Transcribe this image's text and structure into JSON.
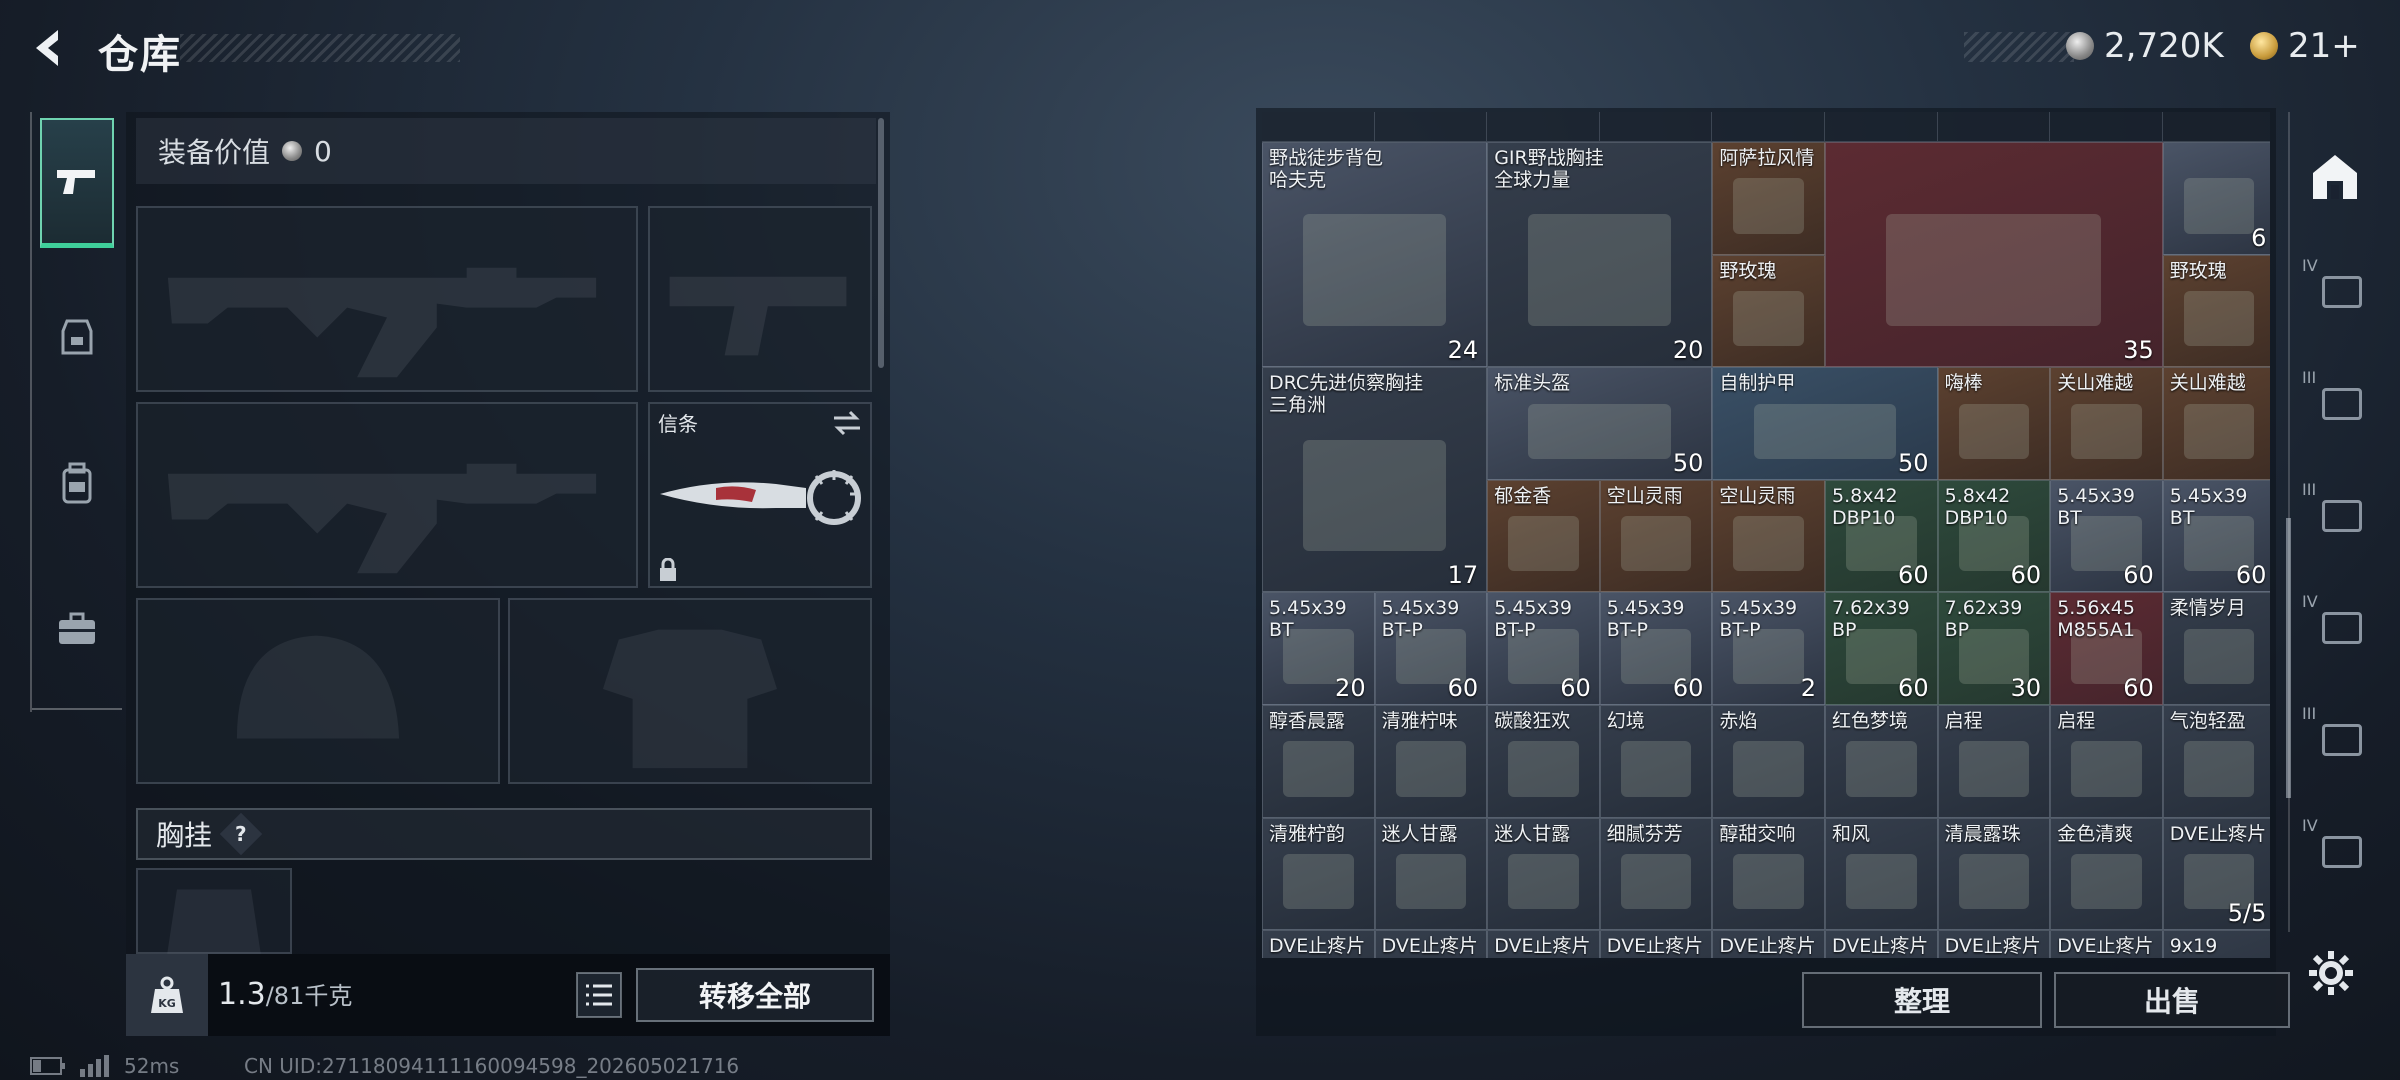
{
  "header": {
    "title": "仓库",
    "currency_silver": "2,720K",
    "currency_gold": "21+"
  },
  "equipment": {
    "value_label": "装备价值",
    "value_amount": "0",
    "knife_slot_label": "信条",
    "chest_rig_label": "胸挂",
    "chest_rig_help": "?",
    "weight_current": "1.3",
    "weight_max": "/81千克",
    "weight_icon_text": "KG",
    "transfer_all": "转移全部"
  },
  "storage": {
    "buttons": {
      "sort": "整理",
      "sell": "出售"
    },
    "items": [
      {
        "name": "野战徒步背包\n哈夫克",
        "count": "24",
        "color": "grey"
      },
      {
        "name": "GIR野战胸挂\n全球力量",
        "count": "20",
        "color": "dark"
      },
      {
        "name": "阿萨拉风情",
        "count": "",
        "color": "orange"
      },
      {
        "name": "",
        "count": "35",
        "color": "red"
      },
      {
        "name": "",
        "count": "6",
        "color": "grey"
      },
      {
        "name": "野玫瑰",
        "count": "",
        "color": "orange"
      },
      {
        "name": "野玫瑰",
        "count": "",
        "color": "orange"
      },
      {
        "name": "DRC先进侦察胸挂\n三角洲",
        "count": "17",
        "color": "dark"
      },
      {
        "name": "标准头盔",
        "count": "50",
        "color": "grey"
      },
      {
        "name": "自制护甲",
        "count": "50",
        "color": "blue"
      },
      {
        "name": "嗨棒",
        "count": "",
        "color": "orange"
      },
      {
        "name": "关山难越",
        "count": "",
        "color": "orange"
      },
      {
        "name": "关山难越",
        "count": "",
        "color": "orange"
      },
      {
        "name": "郁金香",
        "count": "",
        "color": "orange"
      },
      {
        "name": "空山灵雨",
        "count": "",
        "color": "orange"
      },
      {
        "name": "空山灵雨",
        "count": "",
        "color": "orange"
      },
      {
        "name": "5.8x42\nDBP10",
        "count": "60",
        "color": "green"
      },
      {
        "name": "5.8x42\nDBP10",
        "count": "60",
        "color": "green"
      },
      {
        "name": "5.45x39\nBT",
        "count": "60",
        "color": "grey"
      },
      {
        "name": "5.45x39\nBT",
        "count": "60",
        "color": "grey"
      },
      {
        "name": "5.45x39\nBT",
        "count": "20",
        "color": "grey"
      },
      {
        "name": "5.45x39\nBT-P",
        "count": "60",
        "color": "grey"
      },
      {
        "name": "5.45x39\nBT-P",
        "count": "60",
        "color": "grey"
      },
      {
        "name": "5.45x39\nBT-P",
        "count": "60",
        "color": "grey"
      },
      {
        "name": "5.45x39\nBT-P",
        "count": "2",
        "color": "grey"
      },
      {
        "name": "7.62x39\nBP",
        "count": "60",
        "color": "green"
      },
      {
        "name": "7.62x39\nBP",
        "count": "30",
        "color": "green"
      },
      {
        "name": "5.56x45\nM855A1",
        "count": "60",
        "color": "red"
      },
      {
        "name": "柔情岁月",
        "count": "",
        "color": "dark"
      },
      {
        "name": "醇香晨露",
        "count": "",
        "color": "dark"
      },
      {
        "name": "清雅柠味",
        "count": "",
        "color": "dark"
      },
      {
        "name": "碳酸狂欢",
        "count": "",
        "color": "dark"
      },
      {
        "name": "幻境",
        "count": "",
        "color": "dark"
      },
      {
        "name": "赤焰",
        "count": "",
        "color": "dark"
      },
      {
        "name": "红色梦境",
        "count": "",
        "color": "dark"
      },
      {
        "name": "启程",
        "count": "",
        "color": "dark"
      },
      {
        "name": "启程",
        "count": "",
        "color": "dark"
      },
      {
        "name": "气泡轻盈",
        "count": "",
        "color": "dark"
      },
      {
        "name": "清雅柠韵",
        "count": "",
        "color": "dark"
      },
      {
        "name": "迷人甘露",
        "count": "",
        "color": "dark"
      },
      {
        "name": "迷人甘露",
        "count": "",
        "color": "dark"
      },
      {
        "name": "细腻芬芳",
        "count": "",
        "color": "dark"
      },
      {
        "name": "醇甜交响",
        "count": "",
        "color": "dark"
      },
      {
        "name": "和风",
        "count": "",
        "color": "dark"
      },
      {
        "name": "清晨露珠",
        "count": "",
        "color": "dark"
      },
      {
        "name": "金色清爽",
        "count": "",
        "color": "dark"
      },
      {
        "name": "DVE止疼片",
        "count": "5/5",
        "color": "dark"
      },
      {
        "name": "DVE止疼片",
        "count": "",
        "color": "dark"
      },
      {
        "name": "DVE止疼片",
        "count": "",
        "color": "dark"
      },
      {
        "name": "DVE止疼片",
        "count": "",
        "color": "dark"
      },
      {
        "name": "DVE止疼片",
        "count": "",
        "color": "dark"
      },
      {
        "name": "DVE止疼片",
        "count": "",
        "color": "dark"
      },
      {
        "name": "DVE止疼片",
        "count": "",
        "color": "dark"
      },
      {
        "name": "DVE止疼片",
        "count": "",
        "color": "dark"
      },
      {
        "name": "DVE止疼片",
        "count": "",
        "color": "dark"
      },
      {
        "name": "9x19",
        "count": "",
        "color": "dark"
      }
    ]
  },
  "right_nav": {
    "roman": [
      "IV",
      "III",
      "III",
      "IV",
      "III",
      "IV"
    ]
  },
  "footer": {
    "ping": "52ms",
    "uid": "CN UID:27118094111160094598_202605021716"
  }
}
